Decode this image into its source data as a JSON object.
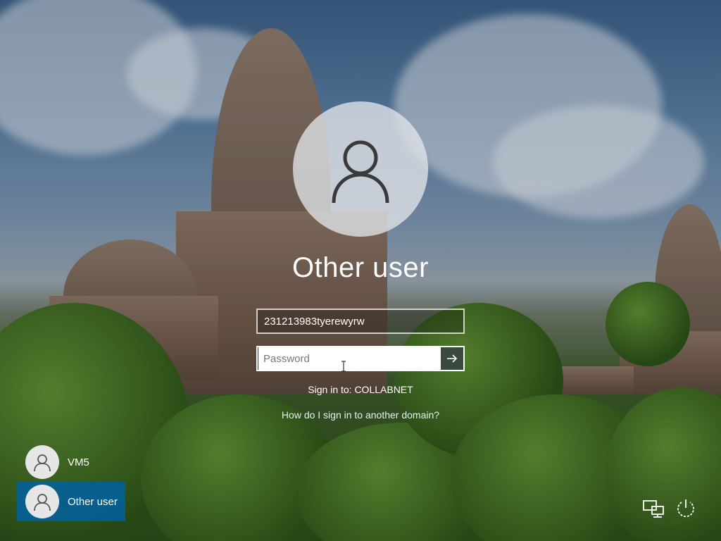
{
  "login": {
    "display_name": "Other user",
    "username_value": "231213983tyerewyrw",
    "password_placeholder": "Password",
    "sign_in_to": "Sign in to: COLLABNET",
    "domain_help_link": "How do I sign in to another domain?"
  },
  "user_list": [
    {
      "name": "VM5",
      "selected": false
    },
    {
      "name": "Other user",
      "selected": true
    }
  ],
  "corner_icons": [
    "network-icon",
    "power-icon"
  ],
  "colors": {
    "selected_user_bg": "#0060a0",
    "submit_button_bg": "#3a4a40",
    "avatar_circle": "#e1e4e8"
  }
}
